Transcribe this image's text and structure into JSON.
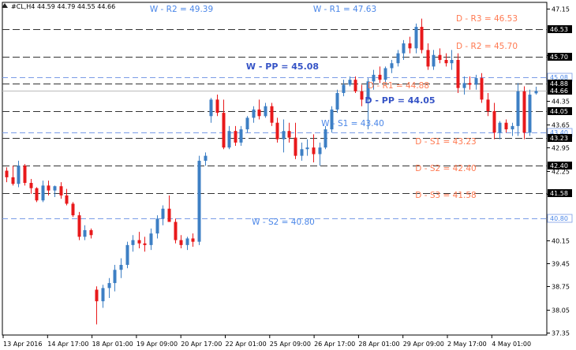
{
  "header": {
    "text": "#CL,H4  44.59 44.79 44.55 44.66"
  },
  "chart_data": {
    "type": "candlestick",
    "symbol": "#CL,H4",
    "ohlc_header": [
      44.59,
      44.79,
      44.55,
      44.66
    ],
    "ylim": [
      37.0,
      47.35
    ],
    "grid": false,
    "legend": "none",
    "colors": {
      "up": "#3d7fc4",
      "down": "#e8191b",
      "daily": "#333333",
      "weekly": "#7a9ce6",
      "daily_text": "#ff7a52",
      "weekly_text": "#4a86e8",
      "pp_bold": "#3553c6"
    },
    "y_ticks": [
      "47.15",
      "45.75",
      "45.05",
      "44.35",
      "43.65",
      "42.95",
      "42.25",
      "41.55",
      "40.85",
      "40.15",
      "39.45",
      "38.75",
      "38.05",
      "37.35"
    ],
    "y_tick_values": [
      47.15,
      45.75,
      45.05,
      44.35,
      43.65,
      42.95,
      42.25,
      41.55,
      40.85,
      40.15,
      39.45,
      38.75,
      38.05,
      37.35
    ],
    "x_ticks": [
      "13 Apr 2016",
      "14 Apr 17:00",
      "18 Apr 01:00",
      "19 Apr 09:00",
      "20 Apr 17:00",
      "22 Apr 01:00",
      "25 Apr 09:00",
      "26 Apr 17:00",
      "28 Apr 01:00",
      "29 Apr 09:00",
      "2 May 17:00",
      "4 May 01:00"
    ],
    "levels": [
      {
        "label": "W - R2 = 49.39",
        "value": 49.39,
        "kind": "weekly",
        "bold": false,
        "line": false,
        "tag": ""
      },
      {
        "label": "W - R1 = 47.63",
        "value": 47.63,
        "kind": "weekly",
        "bold": false,
        "line": false,
        "tag": ""
      },
      {
        "label": "D - R3 = 46.53",
        "value": 46.53,
        "kind": "daily",
        "bold": false,
        "line": true,
        "tag": "46.53"
      },
      {
        "label": "D - R2 = 45.70",
        "value": 45.7,
        "kind": "daily",
        "bold": false,
        "line": true,
        "tag": "45.70"
      },
      {
        "label": "W - PP = 45.08",
        "value": 45.08,
        "kind": "weekly",
        "bold": true,
        "line": true,
        "tag": "45.08"
      },
      {
        "label": "D - R1 = 44.88",
        "value": 44.88,
        "kind": "daily",
        "bold": false,
        "line": true,
        "tag": "44.88"
      },
      {
        "label": "D - PP = 44.05",
        "value": 44.05,
        "kind": "daily",
        "bold": true,
        "line": true,
        "tag": "44.05"
      },
      {
        "label": "W - S1 = 43.40",
        "value": 43.4,
        "kind": "weekly",
        "bold": false,
        "line": true,
        "tag": "43.40"
      },
      {
        "label": "D - S1 = 43.23",
        "value": 43.23,
        "kind": "daily",
        "bold": false,
        "line": true,
        "tag": "43.23"
      },
      {
        "label": "D - S2 = 42.40",
        "value": 42.4,
        "kind": "daily",
        "bold": false,
        "line": true,
        "tag": "42.40"
      },
      {
        "label": "D - S3 = 41.58",
        "value": 41.58,
        "kind": "daily",
        "bold": false,
        "line": true,
        "tag": "41.58"
      },
      {
        "label": "W - S2 = 40.80",
        "value": 40.8,
        "kind": "weekly",
        "bold": false,
        "line": true,
        "tag": "40.80"
      }
    ],
    "current_price": {
      "value": 44.66,
      "tag": "44.66"
    },
    "candles": [
      [
        42.25,
        42.35,
        41.9,
        42.05
      ],
      [
        42.05,
        42.4,
        41.8,
        41.85
      ],
      [
        41.85,
        42.55,
        41.75,
        42.4
      ],
      [
        42.4,
        42.45,
        41.8,
        41.88
      ],
      [
        41.88,
        42.0,
        41.55,
        41.72
      ],
      [
        41.72,
        41.75,
        41.3,
        41.35
      ],
      [
        41.35,
        41.95,
        41.3,
        41.8
      ],
      [
        41.8,
        41.95,
        41.5,
        41.65
      ],
      [
        41.65,
        41.8,
        41.45,
        41.78
      ],
      [
        41.78,
        41.9,
        41.4,
        41.5
      ],
      [
        41.5,
        41.7,
        41.2,
        41.25
      ],
      [
        41.25,
        41.3,
        40.85,
        40.9
      ],
      [
        40.9,
        41.0,
        40.15,
        40.25
      ],
      [
        40.25,
        40.6,
        40.15,
        40.45
      ],
      [
        40.45,
        40.5,
        40.2,
        40.3
      ],
      [
        38.65,
        38.75,
        37.6,
        38.3
      ],
      [
        38.3,
        38.8,
        38.1,
        38.7
      ],
      [
        38.7,
        39.0,
        38.4,
        38.85
      ],
      [
        38.85,
        39.4,
        38.6,
        39.25
      ],
      [
        39.25,
        39.6,
        39.0,
        39.4
      ],
      [
        39.4,
        40.1,
        39.3,
        40.0
      ],
      [
        40.0,
        40.3,
        39.8,
        40.15
      ],
      [
        40.15,
        40.4,
        39.9,
        40.05
      ],
      [
        40.05,
        40.25,
        39.8,
        40.0
      ],
      [
        40.0,
        40.5,
        39.85,
        40.35
      ],
      [
        40.35,
        40.9,
        40.2,
        40.8
      ],
      [
        40.8,
        41.2,
        40.6,
        41.1
      ],
      [
        41.1,
        41.5,
        40.9,
        40.7
      ],
      [
        40.7,
        40.8,
        40.05,
        40.15
      ],
      [
        40.15,
        40.3,
        39.9,
        40.0
      ],
      [
        40.0,
        40.25,
        39.85,
        40.2
      ],
      [
        40.2,
        40.35,
        39.95,
        40.1
      ],
      [
        40.1,
        42.7,
        40.0,
        42.55
      ],
      [
        42.55,
        42.8,
        42.4,
        42.7
      ],
      [
        43.9,
        44.45,
        43.7,
        44.4
      ],
      [
        44.4,
        44.55,
        43.9,
        44.0
      ],
      [
        44.0,
        44.4,
        42.9,
        42.95
      ],
      [
        42.95,
        43.6,
        42.9,
        43.45
      ],
      [
        43.45,
        43.6,
        43.0,
        43.1
      ],
      [
        43.1,
        43.6,
        43.0,
        43.5
      ],
      [
        43.5,
        43.9,
        43.4,
        43.85
      ],
      [
        43.85,
        44.2,
        43.7,
        44.1
      ],
      [
        44.1,
        44.4,
        43.8,
        43.9
      ],
      [
        43.9,
        44.3,
        43.85,
        44.2
      ],
      [
        44.2,
        44.3,
        43.6,
        43.7
      ],
      [
        43.7,
        43.85,
        43.1,
        43.2
      ],
      [
        43.2,
        43.8,
        42.8,
        43.45
      ],
      [
        43.45,
        43.7,
        43.1,
        43.25
      ],
      [
        43.25,
        43.7,
        42.6,
        42.7
      ],
      [
        42.7,
        43.1,
        42.55,
        42.9
      ],
      [
        42.9,
        43.2,
        42.7,
        42.95
      ],
      [
        42.95,
        43.35,
        42.5,
        42.75
      ],
      [
        42.75,
        43.1,
        42.4,
        42.95
      ],
      [
        42.95,
        43.6,
        42.9,
        43.5
      ],
      [
        43.5,
        44.2,
        43.4,
        44.1
      ],
      [
        44.1,
        44.7,
        44.0,
        44.6
      ],
      [
        44.6,
        45.0,
        44.5,
        44.85
      ],
      [
        44.85,
        45.1,
        44.8,
        45.0
      ],
      [
        45.0,
        45.1,
        44.6,
        44.65
      ],
      [
        44.65,
        44.85,
        44.2,
        44.4
      ],
      [
        44.4,
        45.05,
        43.5,
        44.95
      ],
      [
        44.95,
        45.3,
        44.7,
        45.15
      ],
      [
        45.15,
        45.4,
        44.9,
        45.0
      ],
      [
        45.0,
        45.4,
        44.9,
        45.35
      ],
      [
        45.35,
        45.6,
        45.2,
        45.5
      ],
      [
        45.5,
        45.9,
        45.4,
        45.8
      ],
      [
        45.8,
        46.2,
        45.6,
        46.1
      ],
      [
        46.1,
        46.3,
        45.8,
        45.95
      ],
      [
        45.95,
        46.7,
        45.8,
        46.6
      ],
      [
        46.6,
        46.85,
        45.8,
        45.9
      ],
      [
        45.9,
        46.1,
        45.3,
        45.4
      ],
      [
        45.4,
        45.9,
        45.3,
        45.75
      ],
      [
        45.75,
        45.95,
        45.5,
        45.6
      ],
      [
        45.6,
        45.8,
        45.4,
        45.5
      ],
      [
        45.5,
        45.9,
        45.3,
        45.6
      ],
      [
        45.6,
        45.8,
        44.6,
        44.75
      ],
      [
        44.75,
        45.1,
        44.55,
        44.9
      ],
      [
        44.9,
        45.1,
        44.7,
        44.85
      ],
      [
        44.85,
        45.15,
        44.7,
        45.05
      ],
      [
        45.05,
        45.2,
        44.3,
        44.4
      ],
      [
        44.4,
        44.6,
        43.9,
        44.05
      ],
      [
        44.05,
        44.3,
        43.2,
        43.4
      ],
      [
        43.4,
        43.75,
        43.2,
        43.7
      ],
      [
        43.7,
        43.8,
        43.4,
        43.5
      ],
      [
        43.5,
        43.7,
        43.3,
        43.6
      ],
      [
        43.6,
        44.9,
        43.3,
        44.65
      ],
      [
        44.65,
        44.8,
        43.2,
        43.4
      ],
      [
        43.4,
        44.7,
        43.3,
        44.55
      ],
      [
        44.59,
        44.79,
        44.55,
        44.66
      ]
    ]
  }
}
